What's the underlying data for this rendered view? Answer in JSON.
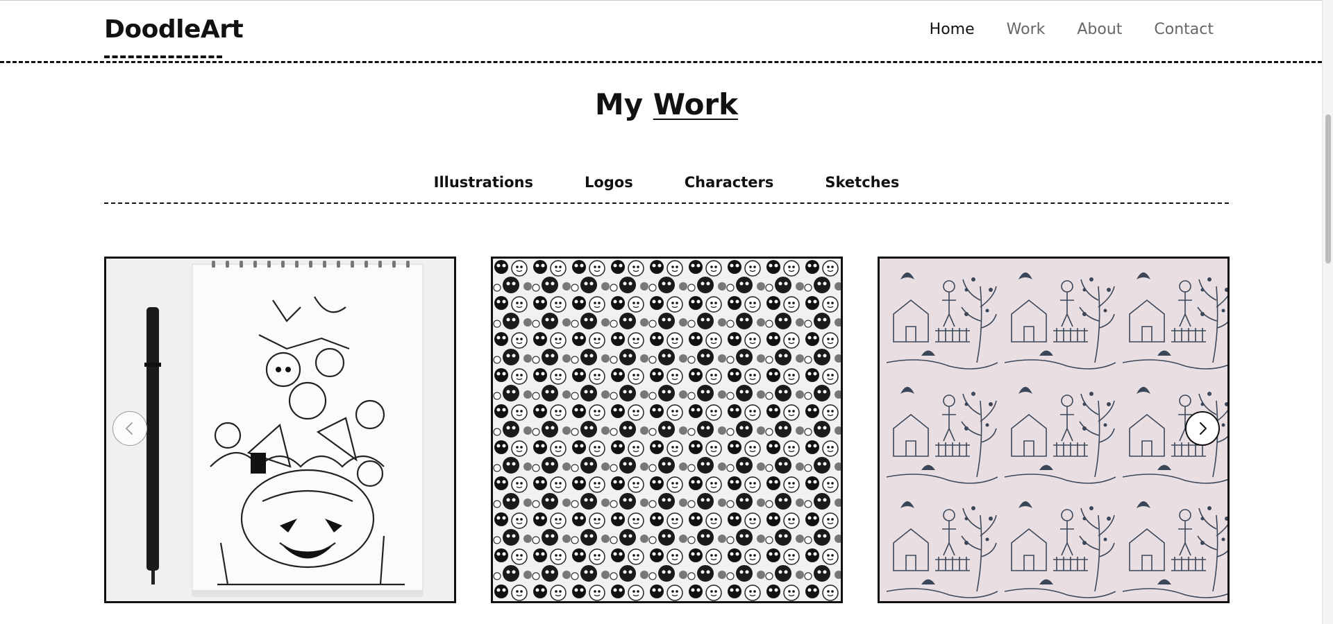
{
  "header": {
    "logo": "DoodleArt",
    "nav": [
      {
        "label": "Home",
        "active": true
      },
      {
        "label": "Work",
        "active": false
      },
      {
        "label": "About",
        "active": false
      },
      {
        "label": "Contact",
        "active": false
      }
    ]
  },
  "section": {
    "title_prefix": "My",
    "title_emphasis": "Work"
  },
  "categories": [
    "Illustrations",
    "Logos",
    "Characters",
    "Sketches"
  ],
  "gallery": {
    "items": [
      {
        "icon": "halloween-doodle-sketchbook-image"
      },
      {
        "icon": "monochrome-characters-pattern-image"
      },
      {
        "icon": "toile-pattern-image"
      }
    ],
    "prev_icon": "chevron-left-icon",
    "next_icon": "chevron-right-icon"
  },
  "colors": {
    "text": "#111111",
    "nav_inactive": "#666666",
    "card_border": "#111111",
    "toile_bg": "#e9dfe3",
    "toile_ink": "#3b4658"
  }
}
